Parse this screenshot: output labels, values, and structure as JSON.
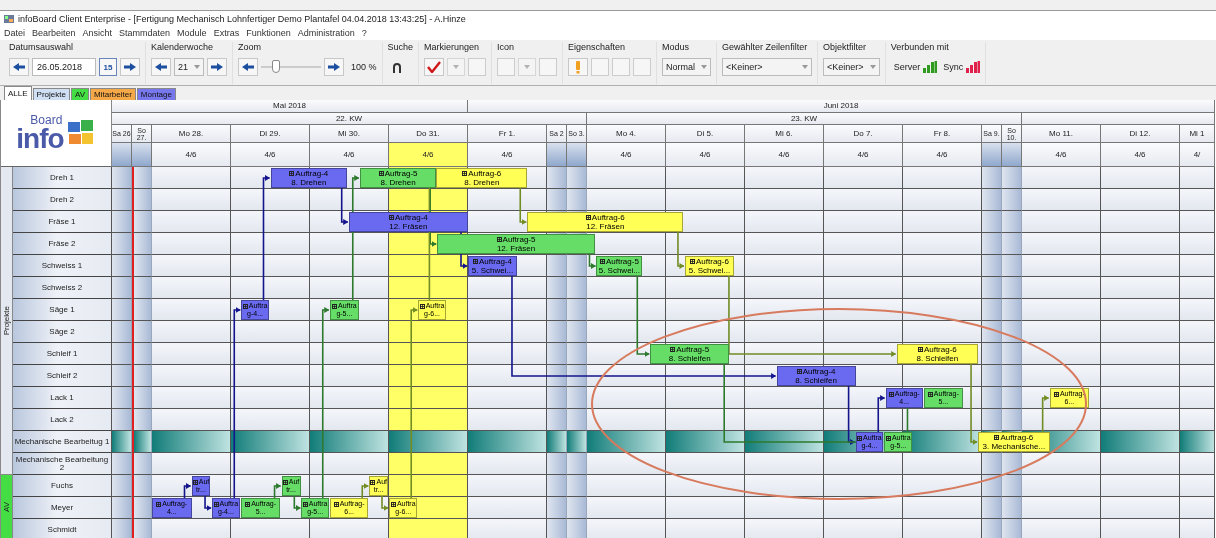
{
  "window": {
    "title": "infoBoard Client Enterprise - [Fertigung Mechanisch Lohnfertiger Demo Plantafel 04.04.2018 13:43:25] - A.Hinze"
  },
  "menu": [
    "Datei",
    "Bearbeiten",
    "Ansicht",
    "Stammdaten",
    "Module",
    "Extras",
    "Funktionen",
    "Administration",
    "?"
  ],
  "toolbar": [
    {
      "label": "Datumsauswahl",
      "controls": [
        {
          "kind": "prev"
        },
        {
          "kind": "field",
          "value": "26.05.2018"
        },
        {
          "kind": "calendar",
          "text": "15"
        },
        {
          "kind": "next"
        }
      ]
    },
    {
      "label": "Kalenderwoche",
      "controls": [
        {
          "kind": "prev"
        },
        {
          "kind": "combo",
          "value": "21"
        },
        {
          "kind": "next"
        }
      ]
    },
    {
      "label": "Zoom",
      "controls": [
        {
          "kind": "prev"
        },
        {
          "kind": "slider",
          "level": 0.25
        },
        {
          "kind": "next"
        },
        {
          "kind": "text",
          "text": "100 %"
        }
      ]
    },
    {
      "label": "Suche",
      "controls": [
        {
          "kind": "search"
        }
      ]
    },
    {
      "label": "Markierungen",
      "controls": [
        {
          "kind": "check",
          "checked": true
        },
        {
          "kind": "dropdown"
        },
        {
          "kind": "blank"
        }
      ]
    },
    {
      "label": "Icon",
      "controls": [
        {
          "kind": "blank"
        },
        {
          "kind": "dropdown"
        },
        {
          "kind": "blank"
        }
      ]
    },
    {
      "label": "Eigenschaften",
      "controls": [
        {
          "kind": "figure"
        },
        {
          "kind": "blank"
        },
        {
          "kind": "blank"
        },
        {
          "kind": "blank"
        }
      ]
    },
    {
      "label": "Modus",
      "controls": [
        {
          "kind": "combo",
          "value": "Normal"
        }
      ]
    },
    {
      "label": "Gewählter Zeilenfilter",
      "controls": [
        {
          "kind": "combo",
          "value": "<Keiner>"
        }
      ]
    },
    {
      "label": "Objektfilter",
      "controls": [
        {
          "kind": "combo",
          "value": "<Keiner>"
        }
      ]
    },
    {
      "label": "Verbunden mit",
      "controls": [
        {
          "kind": "status",
          "text": "Server",
          "color": "#2e9a1e"
        },
        {
          "kind": "status",
          "text": "Sync",
          "color": "#e0204a"
        }
      ]
    }
  ],
  "tabs": [
    {
      "label": "ALLE",
      "selected": true,
      "color": "#ffffff"
    },
    {
      "label": "Projekte",
      "selected": false,
      "color": "#cfe0f5"
    },
    {
      "label": "AV",
      "selected": false,
      "color": "#44dd44"
    },
    {
      "label": "Mitarbeiter",
      "selected": false,
      "color": "#f5a848"
    },
    {
      "label": "Montage",
      "selected": false,
      "color": "#7777ee"
    }
  ],
  "logo": {
    "word": "info",
    "superscript": "Board"
  },
  "months": [
    "Mai 2018",
    "Juni 2018"
  ],
  "weeks": [
    "22. KW",
    "23. KW"
  ],
  "days": [
    {
      "label": "Sa 26",
      "kind": "weekend",
      "today": false,
      "selected": false
    },
    {
      "label": "So 27.",
      "kind": "weekend",
      "today": true,
      "selected": false
    },
    {
      "label": "Mo 28.",
      "kind": "weekday",
      "capacity": "4/6",
      "today": false,
      "selected": false
    },
    {
      "label": "Di 29.",
      "kind": "weekday",
      "capacity": "4/6",
      "today": false,
      "selected": false
    },
    {
      "label": "Mi 30.",
      "kind": "weekday",
      "capacity": "4/6",
      "today": false,
      "selected": false
    },
    {
      "label": "Do 31.",
      "kind": "weekday",
      "capacity": "4/6",
      "today": false,
      "selected": true
    },
    {
      "label": "Fr 1.",
      "kind": "weekday",
      "capacity": "4/6",
      "today": false,
      "selected": false
    },
    {
      "label": "Sa 2",
      "kind": "weekend",
      "today": false,
      "selected": false
    },
    {
      "label": "So 3.",
      "kind": "weekend",
      "today": false,
      "selected": false
    },
    {
      "label": "Mo 4.",
      "kind": "weekday",
      "capacity": "4/6",
      "today": false,
      "selected": false
    },
    {
      "label": "Di 5.",
      "kind": "weekday",
      "capacity": "4/6",
      "today": false,
      "selected": false
    },
    {
      "label": "Mi 6.",
      "kind": "weekday",
      "capacity": "4/6",
      "today": false,
      "selected": false
    },
    {
      "label": "Do 7.",
      "kind": "weekday",
      "capacity": "4/6",
      "today": false,
      "selected": false
    },
    {
      "label": "Fr 8.",
      "kind": "weekday",
      "capacity": "4/6",
      "today": false,
      "selected": false
    },
    {
      "label": "Sa 9.",
      "kind": "weekend",
      "today": false,
      "selected": false
    },
    {
      "label": "So 10.",
      "kind": "weekend",
      "today": false,
      "selected": false
    },
    {
      "label": "Mo 11.",
      "kind": "weekday",
      "capacity": "4/6",
      "today": false,
      "selected": false
    },
    {
      "label": "Di 12.",
      "kind": "weekday",
      "capacity": "4/6",
      "today": false,
      "selected": false
    },
    {
      "label": "Mi 1",
      "kind": "weekday",
      "capacity": "4/",
      "today": false,
      "selected": false
    }
  ],
  "groups": [
    {
      "label": "Projekte",
      "color": "#e4e8f0",
      "rows": [
        {
          "label": "Dreh 1",
          "highlighted": false
        },
        {
          "label": "Dreh 2",
          "highlighted": false
        },
        {
          "label": "Fräse 1",
          "highlighted": false
        },
        {
          "label": "Fräse 2",
          "highlighted": false
        },
        {
          "label": "Schweiss 1",
          "highlighted": false
        },
        {
          "label": "Schweiss 2",
          "highlighted": false
        },
        {
          "label": "Säge 1",
          "highlighted": false
        },
        {
          "label": "Säge 2",
          "highlighted": false
        },
        {
          "label": "Schleif 1",
          "highlighted": false
        },
        {
          "label": "Schleif 2",
          "highlighted": false
        },
        {
          "label": "Lack 1",
          "highlighted": false
        },
        {
          "label": "Lack 2",
          "highlighted": false
        },
        {
          "label": "Mechanische Bearbeitug 1",
          "highlighted": true
        },
        {
          "label": "Mechanische Bearbeitung 2",
          "highlighted": false
        }
      ]
    },
    {
      "label": "AV",
      "color": "#44dd44",
      "rows": [
        {
          "label": "Fuchs",
          "highlighted": false
        },
        {
          "label": "Meyer",
          "highlighted": false
        },
        {
          "label": "Schmidt",
          "highlighted": false
        }
      ]
    }
  ],
  "orders": [
    {
      "color": "#6a6af0",
      "steps": [
        {
          "lines": [
            "Auftrag-",
            "4..."
          ]
        },
        {
          "lines": [
            "Auf",
            "tr..."
          ]
        },
        {
          "lines": [
            "Auftra",
            "g-4..."
          ]
        },
        {
          "lines": [
            "Auftra",
            "g-4..."
          ]
        },
        {
          "lines": [
            "Auftrag-4",
            "8. Drehen"
          ]
        },
        {
          "lines": [
            "Auftrag-4",
            "12. Fräsen"
          ]
        },
        {
          "lines": [
            "Auftrag-4",
            "5. Schwei..."
          ]
        },
        {
          "lines": [
            "Auftrag-4",
            "8. Schleifen"
          ]
        },
        {
          "lines": [
            "Auftra",
            "g-4..."
          ]
        },
        {
          "lines": [
            "Auftrag-",
            "4..."
          ]
        }
      ]
    },
    {
      "color": "#66dd66",
      "steps": [
        {
          "lines": [
            "Auftrag-",
            "5..."
          ]
        },
        {
          "lines": [
            "Auf",
            "tr..."
          ]
        },
        {
          "lines": [
            "Auftra",
            "g-5..."
          ]
        },
        {
          "lines": [
            "Auftra",
            "g-5..."
          ]
        },
        {
          "lines": [
            "Auftrag-5",
            "8. Drehen"
          ]
        },
        {
          "lines": [
            "Auftrag-5",
            "12. Fräsen"
          ]
        },
        {
          "lines": [
            "Auftrag-5",
            "5. Schwei..."
          ]
        },
        {
          "lines": [
            "Auftrag-5",
            "8. Schleifen"
          ]
        },
        {
          "lines": [
            "Auftra",
            "g-5..."
          ]
        },
        {
          "lines": [
            "Auftrag-",
            "5..."
          ]
        }
      ]
    },
    {
      "color": "#ffff55",
      "steps": [
        {
          "lines": [
            "Auftrag-",
            "6..."
          ]
        },
        {
          "lines": [
            "Auf",
            "tr..."
          ]
        },
        {
          "lines": [
            "Auftra",
            "g-6..."
          ]
        },
        {
          "lines": [
            "Auftra",
            "g-6..."
          ]
        },
        {
          "lines": [
            "Auftrag-6",
            "8. Drehen"
          ]
        },
        {
          "lines": [
            "Auftrag-6",
            "12. Fräsen"
          ]
        },
        {
          "lines": [
            "Auftrag-6",
            "5. Schwei..."
          ]
        },
        {
          "lines": [
            "Auftrag-6",
            "8. Schleifen"
          ]
        },
        {
          "lines": [
            "Auftrag-6",
            "3. Mechanische..."
          ]
        },
        {
          "lines": [
            "Auftrag-",
            "6..."
          ]
        }
      ]
    }
  ]
}
